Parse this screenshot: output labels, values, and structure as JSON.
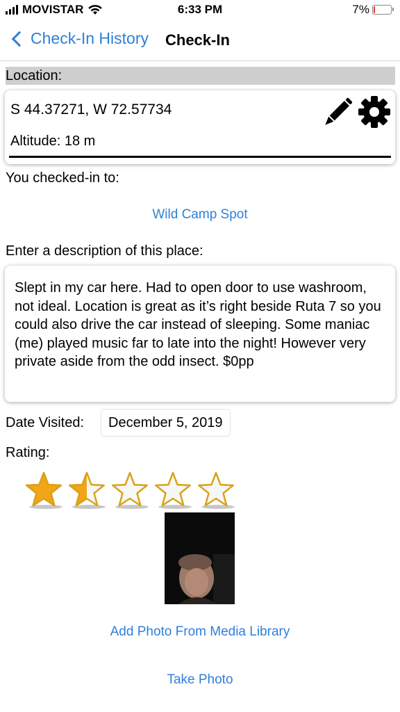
{
  "status_bar": {
    "carrier": "MOVISTAR",
    "time": "6:33 PM",
    "battery": "7%",
    "battery_level": 0.07
  },
  "nav": {
    "back_label": "Check-In History",
    "title": "Check-In"
  },
  "location": {
    "header": "Location:",
    "coords": "S 44.37271, W 72.57734",
    "altitude": "Altitude: 18 m"
  },
  "checkin": {
    "label": "You checked-in to:",
    "place": "Wild Camp Spot"
  },
  "description": {
    "label": "Enter a description of this place:",
    "text": "Slept in my car here. Had to open door to use washroom, not ideal. Location is great as it’s right beside Ruta 7 so you could also drive the car instead of sleeping. Some maniac (me) played music far to late into the night! However very private aside from the odd insect. $0pp"
  },
  "date": {
    "label": "Date Visited:",
    "value": "December 5, 2019"
  },
  "rating": {
    "label": "Rating:",
    "value": 1.5,
    "max": 5
  },
  "actions": {
    "add_photo": "Add Photo From Media Library",
    "take_photo": "Take Photo"
  },
  "colors": {
    "accent": "#2f7fd8",
    "star_fill": "#f2a516",
    "star_outline": "#d9a21a",
    "header_bg": "#cfcfcf"
  }
}
